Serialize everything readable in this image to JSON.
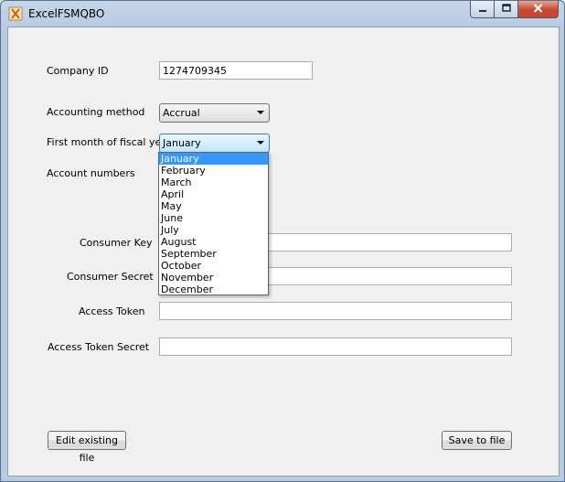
{
  "window": {
    "title": "ExcelFSMQBO",
    "accent": "#3399ff",
    "close_color": "#c9462c"
  },
  "form": {
    "company_id_label": "Company ID",
    "company_id_value": "1274709345",
    "accounting_method_label": "Accounting method",
    "accounting_method_value": "Accrual",
    "fiscal_month_label": "First month of fiscal year",
    "fiscal_month_value": "January",
    "fiscal_month_options": [
      "January",
      "February",
      "March",
      "April",
      "May",
      "June",
      "July",
      "August",
      "September",
      "October",
      "November",
      "December"
    ],
    "account_numbers_label": "Account numbers",
    "consumer_key_label": "Consumer Key",
    "consumer_key_value": "",
    "consumer_secret_label": "Consumer Secret",
    "consumer_secret_value": "",
    "access_token_label": "Access Token",
    "access_token_value": "",
    "access_token_secret_label": "Access Token Secret",
    "access_token_secret_value": ""
  },
  "buttons": {
    "edit_existing_label": "Edit existing file",
    "save_label": "Save to file"
  },
  "icons": {
    "app": "excel-app-icon",
    "minimize": "minimize-icon",
    "maximize": "maximize-icon",
    "close": "close-icon",
    "dropdown": "chevron-down-icon"
  }
}
